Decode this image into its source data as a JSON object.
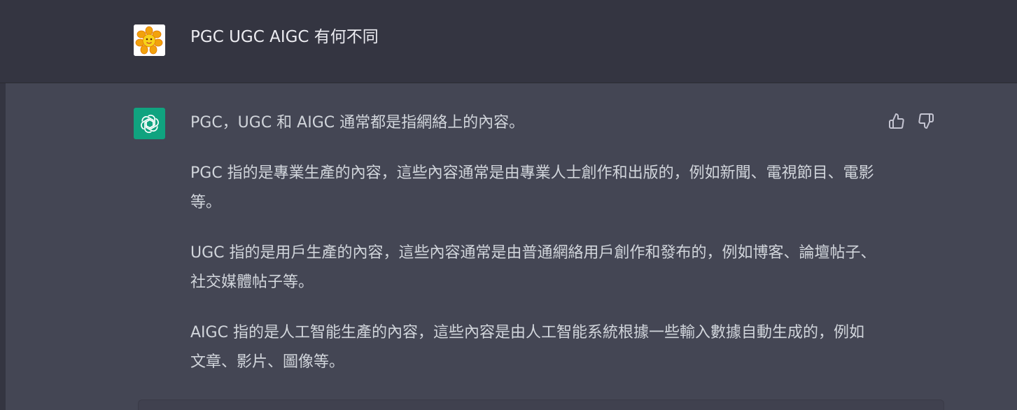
{
  "user_message": {
    "text": "PGC UGC AIGC 有何不同"
  },
  "assistant_message": {
    "paragraphs": [
      "PGC，UGC 和 AIGC 通常都是指網絡上的內容。",
      "PGC 指的是專業生產的內容，這些內容通常是由專業人士創作和出版的，例如新聞、電視節目、電影等。",
      "UGC 指的是用戶生產的內容，這些內容通常是由普通網絡用戶創作和發布的，例如博客、論壇帖子、社交媒體帖子等。",
      "AIGC 指的是人工智能生產的內容，這些內容是由人工智能系統根據一些輸入數據自動生成的，例如文章、影片、圖像等。"
    ]
  },
  "icons": {
    "user_avatar": "flower-avatar-icon",
    "assistant_avatar": "openai-logo-icon",
    "like": "thumbs-up-icon",
    "dislike": "thumbs-down-icon"
  },
  "colors": {
    "background": "#343541",
    "assistant_background": "#444654",
    "assistant_avatar": "#10A37F",
    "text": "#D1D5DB"
  }
}
